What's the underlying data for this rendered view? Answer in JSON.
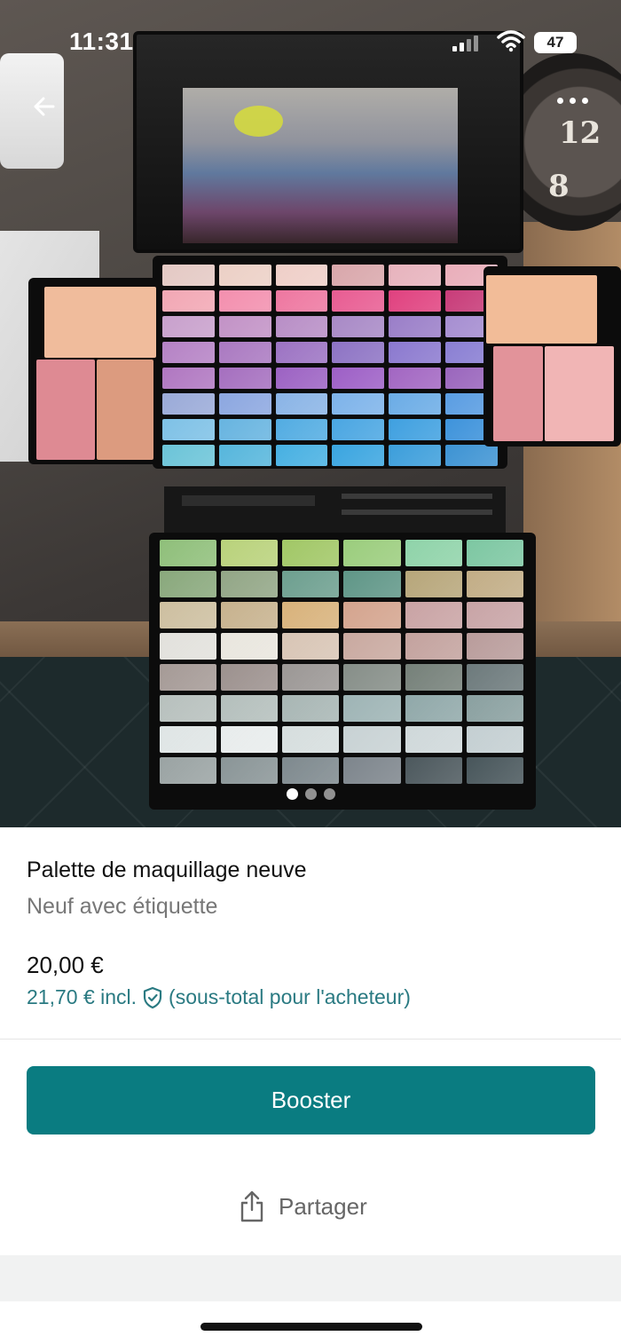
{
  "status_bar": {
    "time": "11:31",
    "battery": "47"
  },
  "gallery": {
    "image_alt": "palette-photo",
    "page_count": 3,
    "current_page": 1
  },
  "listing": {
    "title": "Palette de maquillage neuve",
    "condition": "Neuf avec étiquette",
    "price": "20,00 €",
    "buyer_price_amount": "21,70 € incl.",
    "buyer_price_note": "(sous-total pour l'acheteur)"
  },
  "actions": {
    "booster_label": "Booster",
    "share_label": "Partager"
  },
  "colors": {
    "accent": "#0a7c81",
    "accent_text": "#2a7a82"
  },
  "icons": {
    "back": "arrow-left-icon",
    "more": "more-dots-icon",
    "shield": "shield-check-icon",
    "share": "share-icon"
  }
}
